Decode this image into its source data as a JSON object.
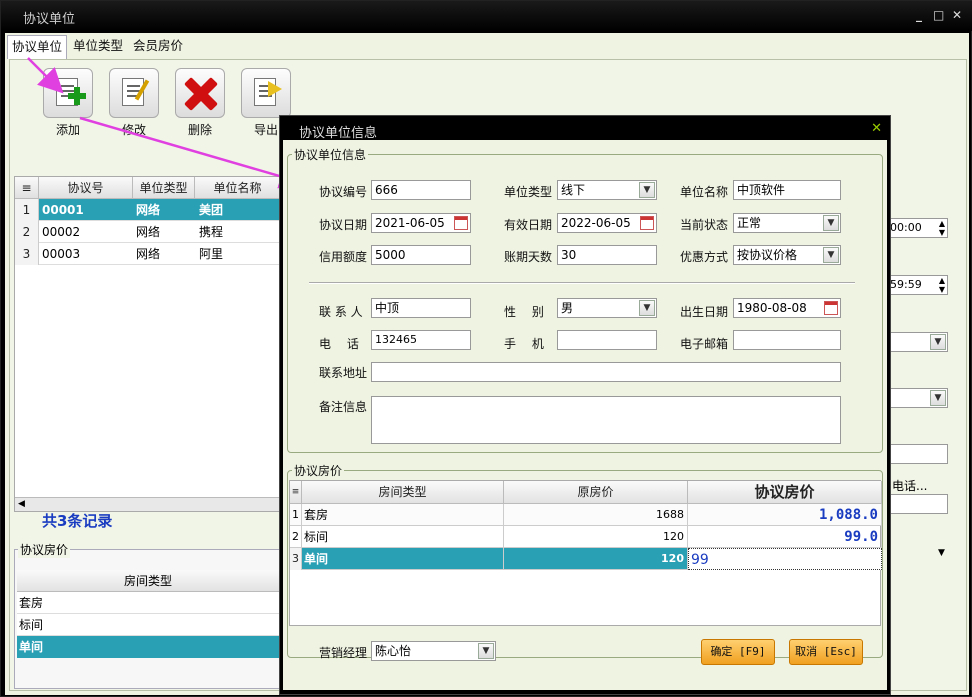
{
  "window": {
    "title": "协议单位",
    "minimize": "_",
    "maximize": "□",
    "close": "✕"
  },
  "tabs": [
    {
      "label": "协议单位"
    },
    {
      "label": "单位类型"
    },
    {
      "label": "会员房价"
    }
  ],
  "toolbar": {
    "add": "添加",
    "edit": "修改",
    "delete": "删除",
    "export": "导出"
  },
  "left_grid": {
    "headers": [
      "协议号",
      "单位类型",
      "单位名称"
    ],
    "rows": [
      {
        "num": "1",
        "code": "00001",
        "type": "网络",
        "name": "美团"
      },
      {
        "num": "2",
        "code": "00002",
        "type": "网络",
        "name": "携程"
      },
      {
        "num": "3",
        "code": "00003",
        "type": "网络",
        "name": "阿里"
      }
    ],
    "record_count": "共3条记录"
  },
  "left_price": {
    "legend": "协议房价",
    "header": "房间类型",
    "rows": [
      "套房",
      "标间",
      "单间"
    ]
  },
  "right_partial": {
    "time1": "00:00",
    "time2": "59:59",
    "phone_label": "电话..."
  },
  "dialog": {
    "title": "协议单位信息",
    "close": "✕",
    "info_legend": "协议单位信息",
    "labels": {
      "code": "协议编号",
      "unit_type": "单位类型",
      "unit_name": "单位名称",
      "agree_date": "协议日期",
      "valid_date": "有效日期",
      "status": "当前状态",
      "credit": "信用额度",
      "account_days": "账期天数",
      "discount": "优惠方式",
      "contact": "联 系 人",
      "gender": "性　 别",
      "birthday": "出生日期",
      "phone": "电　 话",
      "mobile": "手　 机",
      "email": "电子邮箱",
      "address": "联系地址",
      "remark": "备注信息"
    },
    "values": {
      "code": "666",
      "unit_type": "线下",
      "unit_name": "中顶软件",
      "agree_date": "2021-06-05",
      "valid_date": "2022-06-05",
      "status": "正常",
      "credit": "5000",
      "account_days": "30",
      "discount": "按协议价格",
      "contact": "中顶",
      "gender": "男",
      "birthday": "1980-08-08",
      "phone": "132465",
      "mobile": "",
      "email": "",
      "address": "",
      "remark": ""
    },
    "price_legend": "协议房价",
    "price_headers": [
      "房间类型",
      "原房价",
      "协议房价"
    ],
    "price_rows": [
      {
        "num": "1",
        "type": "套房",
        "orig": "1688",
        "agree": "1,088.0"
      },
      {
        "num": "2",
        "type": "标间",
        "orig": "120",
        "agree": "99.0"
      },
      {
        "num": "3",
        "type": "单间",
        "orig": "120",
        "agree": "99"
      }
    ],
    "manager_label": "营销经理",
    "manager_value": "陈心怡",
    "ok": "确定 [F9]",
    "cancel": "取消 [Esc]"
  },
  "colors": {
    "selection": "#2aa0b5",
    "panel": "#eef3e2",
    "accent_arrow": "#e040e0",
    "button": "#f0a020"
  }
}
